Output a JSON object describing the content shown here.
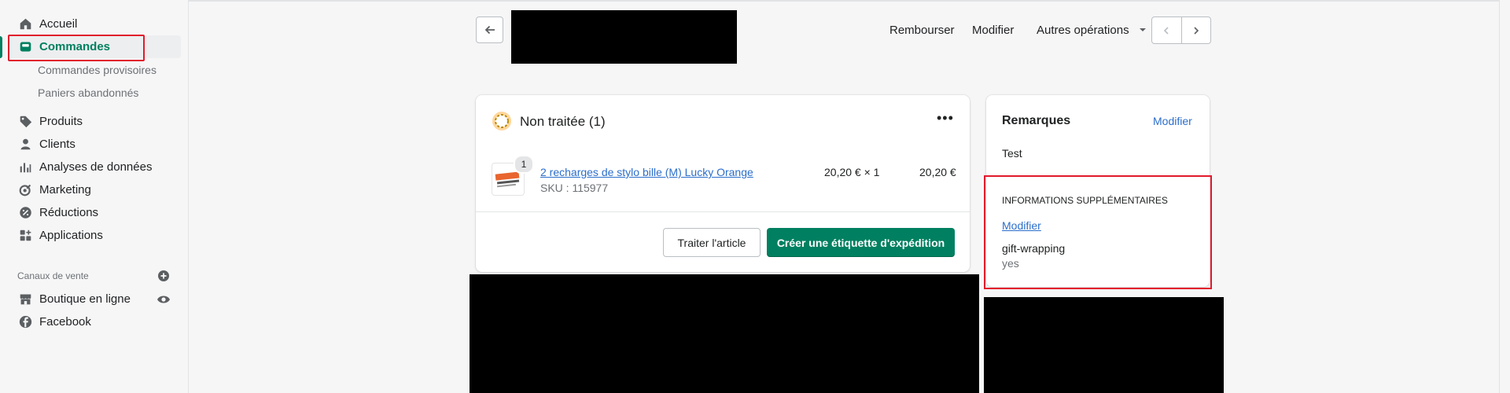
{
  "sidebar": {
    "items": [
      {
        "label": "Accueil",
        "icon": "home-icon"
      },
      {
        "label": "Commandes",
        "icon": "orders-icon"
      },
      {
        "label": "Produits",
        "icon": "tag-icon"
      },
      {
        "label": "Clients",
        "icon": "person-icon"
      },
      {
        "label": "Analyses de données",
        "icon": "bar-chart-icon"
      },
      {
        "label": "Marketing",
        "icon": "target-icon"
      },
      {
        "label": "Réductions",
        "icon": "discount-icon"
      },
      {
        "label": "Applications",
        "icon": "apps-icon"
      }
    ],
    "sub_items": [
      "Commandes provisoires",
      "Paniers abandonnés"
    ],
    "channels_title": "Canaux de vente",
    "channels": [
      {
        "label": "Boutique en ligne",
        "icon": "store-icon"
      },
      {
        "label": "Facebook",
        "icon": "facebook-icon"
      }
    ],
    "active_color": "#008060"
  },
  "header": {
    "refund": "Rembourser",
    "edit": "Modifier",
    "more_actions": "Autres opérations"
  },
  "order_card": {
    "status_title": "Non traitée (1)",
    "status_color": "#ffc453",
    "item": {
      "quantity_badge": "1",
      "title": "2 recharges de stylo bille (M) Lucky Orange",
      "sku": "SKU : 115977",
      "unit_price": "20,20 € × 1",
      "total": "20,20 €"
    },
    "process_button": "Traiter l'article",
    "label_button": "Créer une étiquette d'expédition",
    "primary_color": "#008060"
  },
  "notes_card": {
    "title": "Remarques",
    "edit": "Modifier",
    "note": "Test",
    "extra_title": "INFORMATIONS SUPPLÉMENTAIRES",
    "extra_edit": "Modifier",
    "extra_key": "gift-wrapping",
    "extra_value": "yes"
  },
  "annotation_color": "#e21a2c"
}
